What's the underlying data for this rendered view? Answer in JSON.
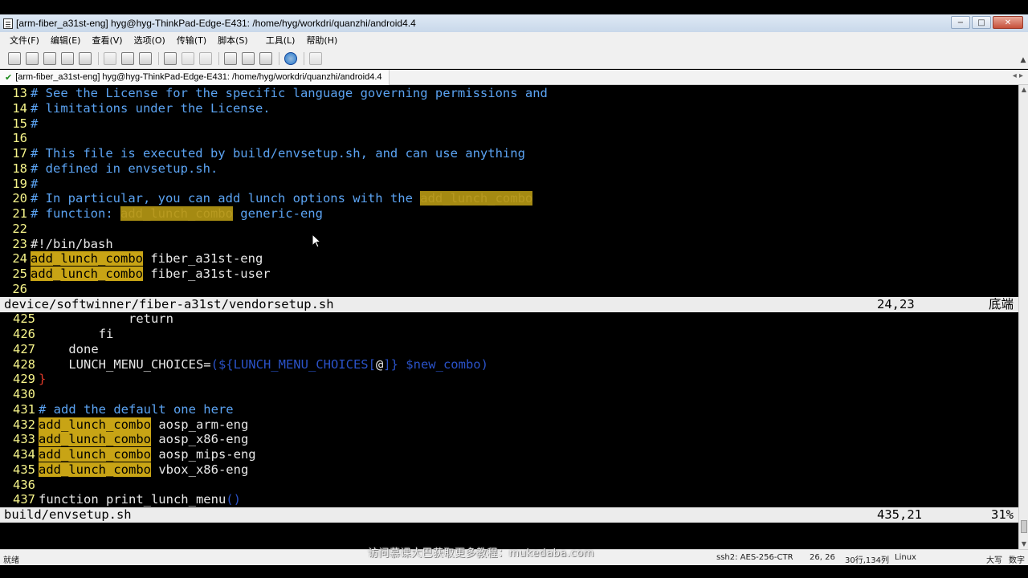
{
  "window": {
    "title": "[arm-fiber_a31st-eng] hyg@hyg-ThinkPad-Edge-E431: /home/hyg/workdri/quanzhi/android4.4",
    "minimize": "−",
    "maximize": "□",
    "close": "✕"
  },
  "menubar": {
    "items": [
      "文件(F)",
      "编辑(E)",
      "查看(V)",
      "选项(O)",
      "传输(T)",
      "脚本(S)",
      "工具(L)",
      "帮助(H)"
    ]
  },
  "tab": {
    "label": "[arm-fiber_a31st-eng] hyg@hyg-ThinkPad-Edge-E431: /home/hyg/workdri/quanzhi/android4.4",
    "nav": "◂ ▸"
  },
  "pane_top": {
    "lines": [
      {
        "n": "13",
        "t": "# See the License for the specific language governing permissions and"
      },
      {
        "n": "14",
        "t": "# limitations under the License."
      },
      {
        "n": "15",
        "t": "#"
      },
      {
        "n": "16",
        "t": ""
      },
      {
        "n": "17",
        "t": "# This file is executed by build/envsetup.sh, and can use anything"
      },
      {
        "n": "18",
        "t": "# defined in envsetup.sh."
      },
      {
        "n": "19",
        "t": "#"
      },
      {
        "n": "20",
        "a": "# In particular, you can add lunch options with the ",
        "h": "add_lunch_combo"
      },
      {
        "n": "21",
        "a": "# function: ",
        "h": "add_lunch_combo",
        "b": " generic-eng"
      },
      {
        "n": "22",
        "t": ""
      },
      {
        "n": "23",
        "t": "#!/bin/bash"
      },
      {
        "n": "24",
        "h": "add_lunch_combo",
        "b": " fiber_a31st-eng"
      },
      {
        "n": "25",
        "h": "add_lunch_combo",
        "b": " fiber_a31st-user"
      },
      {
        "n": "26",
        "t": ""
      }
    ],
    "status_file": "device/softwinner/fiber-a31st/vendorsetup.sh",
    "status_pos": "24,23",
    "status_pct": "底端"
  },
  "pane_bottom": {
    "lines": [
      {
        "n": "425",
        "t": "            return"
      },
      {
        "n": "426",
        "t": "        fi"
      },
      {
        "n": "427",
        "t": "    done"
      },
      {
        "n": "428",
        "pre": "    LUNCH_MENU_CHOICES=",
        "s1": "(${LUNCH_MENU_CHOICES[",
        "at": "@",
        "s2": "]} $new_combo)"
      },
      {
        "n": "429",
        "red": "}"
      },
      {
        "n": "430",
        "t": ""
      },
      {
        "n": "431",
        "c": "# add the default one here"
      },
      {
        "n": "432",
        "h": "add_lunch_combo",
        "b": " aosp_arm-eng"
      },
      {
        "n": "433",
        "h": "add_lunch_combo",
        "b": " aosp_x86-eng"
      },
      {
        "n": "434",
        "h": "add_lunch_combo",
        "b": " aosp_mips-eng"
      },
      {
        "n": "435",
        "h": "add_lunch_combo",
        "b": " vbox_x86-eng"
      },
      {
        "n": "436",
        "t": ""
      },
      {
        "n": "437",
        "pre": "function print_lunch_menu",
        "s1": "()"
      }
    ],
    "status_file": "build/envsetup.sh",
    "status_pos": "435,21",
    "status_pct": "31%"
  },
  "statusbar": {
    "ready": "就绪",
    "cipher": "ssh2: AES-256-CTR",
    "cursor": "26, 26",
    "size": "30行,134列",
    "os": "Linux",
    "caps": "大写",
    "num": "数字"
  },
  "watermark": "访问慕课大巴获取更多教程：mukedaba.com",
  "colors": {
    "terminal_bg": "#000000",
    "line_number": "#f7f58a",
    "comment": "#5ba3f2",
    "highlight": "#c8a415",
    "status_bar": "#ececec"
  }
}
